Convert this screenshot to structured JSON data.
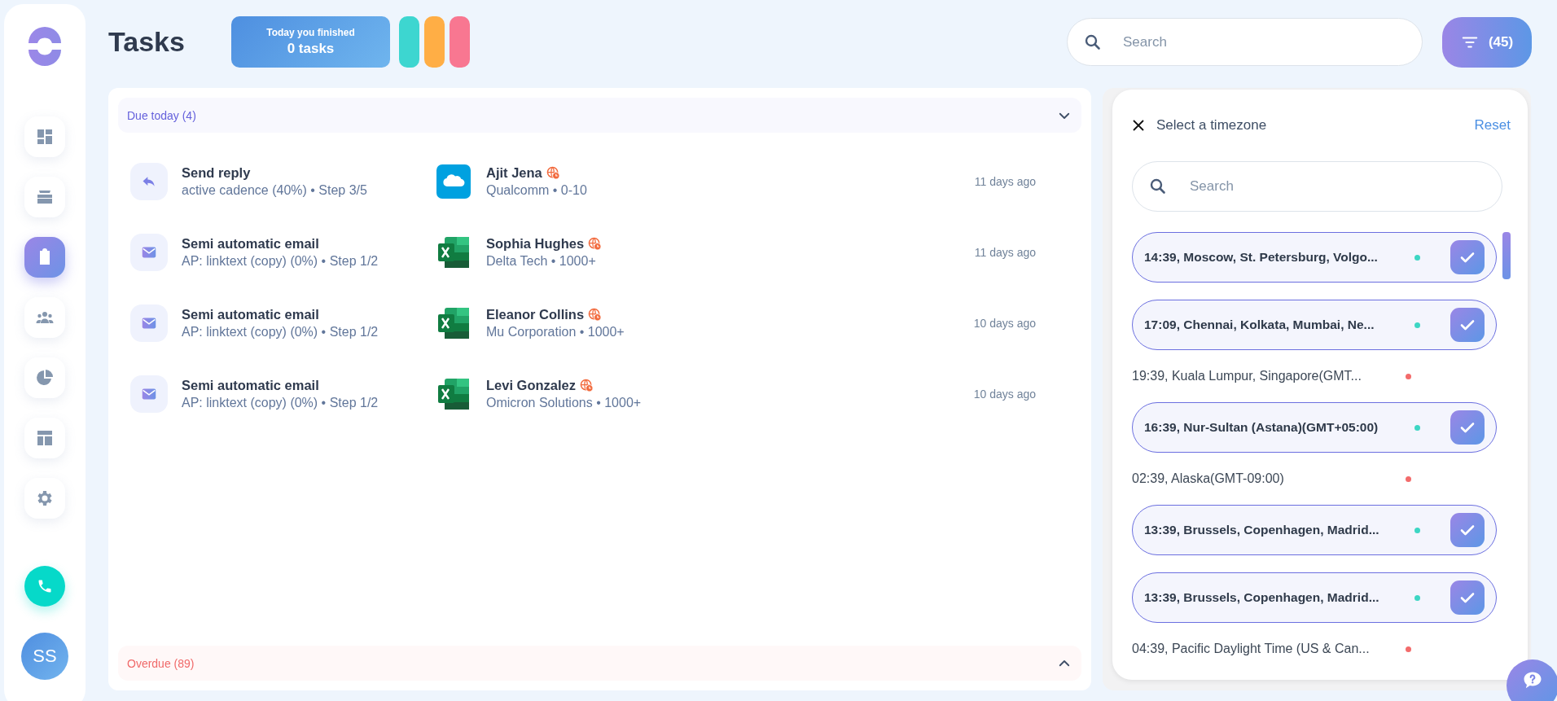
{
  "sidebar": {
    "items": [
      {
        "kind": "dashboard",
        "selected": false
      },
      {
        "kind": "inbox",
        "selected": false
      },
      {
        "kind": "tasks",
        "selected": true
      },
      {
        "kind": "people",
        "selected": false
      },
      {
        "kind": "reports",
        "selected": false
      },
      {
        "kind": "templates",
        "selected": false
      },
      {
        "kind": "settings",
        "selected": false
      }
    ],
    "avatar": "SS"
  },
  "header": {
    "title": "Tasks",
    "today_card": {
      "label": "Today you finished",
      "value": "0 tasks"
    },
    "stat_pills": [
      {
        "color": "#3dd6d0"
      },
      {
        "color": "#ffae45"
      },
      {
        "color": "#f87791"
      }
    ],
    "search": {
      "placeholder": "Search"
    },
    "filter_button": "(45)"
  },
  "sections": [
    {
      "kind": "due",
      "title": "Due today (4)",
      "expanded": true,
      "rows": [
        {
          "icon": {
            "kind": "reply"
          },
          "task": "Send reply",
          "detail": "active cadence (40%) • Step 3/5",
          "app": {
            "kind": "salesforce"
          },
          "contact": "Ajit Jena",
          "company": "Qualcomm • 0-10",
          "time": "11 days ago"
        },
        {
          "icon": {
            "kind": "email"
          },
          "task": "Semi automatic email",
          "detail": "AP: linktext (copy) (0%) • Step 1/2",
          "app": {
            "kind": "excel"
          },
          "contact": "Sophia Hughes",
          "company": "Delta Tech • 1000+",
          "time": "11 days ago"
        },
        {
          "icon": {
            "kind": "email"
          },
          "task": "Semi automatic email",
          "detail": "AP: linktext (copy) (0%) • Step 1/2",
          "app": {
            "kind": "excel"
          },
          "contact": "Eleanor Collins",
          "company": "Mu Corporation • 1000+",
          "time": "10 days ago"
        },
        {
          "icon": {
            "kind": "email"
          },
          "task": "Semi automatic email",
          "detail": "AP: linktext (copy) (0%) • Step 1/2",
          "app": {
            "kind": "excel"
          },
          "contact": "Levi Gonzalez",
          "company": "Omicron Solutions • 1000+",
          "time": "10 days ago"
        }
      ]
    },
    {
      "kind": "overdue",
      "title": "Overdue (89)",
      "expanded": false
    }
  ],
  "timezone_panel": {
    "title": "Select a timezone",
    "reset": "Reset",
    "search": {
      "placeholder": "Search"
    },
    "items": [
      {
        "label": "14:39, Moscow, St. Petersburg, Volgo...",
        "selected": true,
        "color": "#3dd6c4"
      },
      {
        "label": "17:09, Chennai, Kolkata, Mumbai, Ne...",
        "selected": true,
        "color": "#3dd6c4"
      },
      {
        "label": "19:39, Kuala Lumpur, Singapore(GMT...",
        "selected": false,
        "color": "#f36b6b"
      },
      {
        "label": "16:39, Nur-Sultan (Astana)(GMT+05:00)",
        "selected": true,
        "color": "#3dd6c4"
      },
      {
        "label": "02:39, Alaska(GMT-09:00)",
        "selected": false,
        "color": "#f36b6b"
      },
      {
        "label": "13:39, Brussels, Copenhagen, Madrid...",
        "selected": true,
        "color": "#3dd6c4"
      },
      {
        "label": "13:39, Brussels, Copenhagen, Madrid...",
        "selected": true,
        "color": "#3dd6c4"
      },
      {
        "label": "04:39, Pacific Daylight Time (US & Can...",
        "selected": false,
        "color": "#f36b6b"
      }
    ]
  }
}
